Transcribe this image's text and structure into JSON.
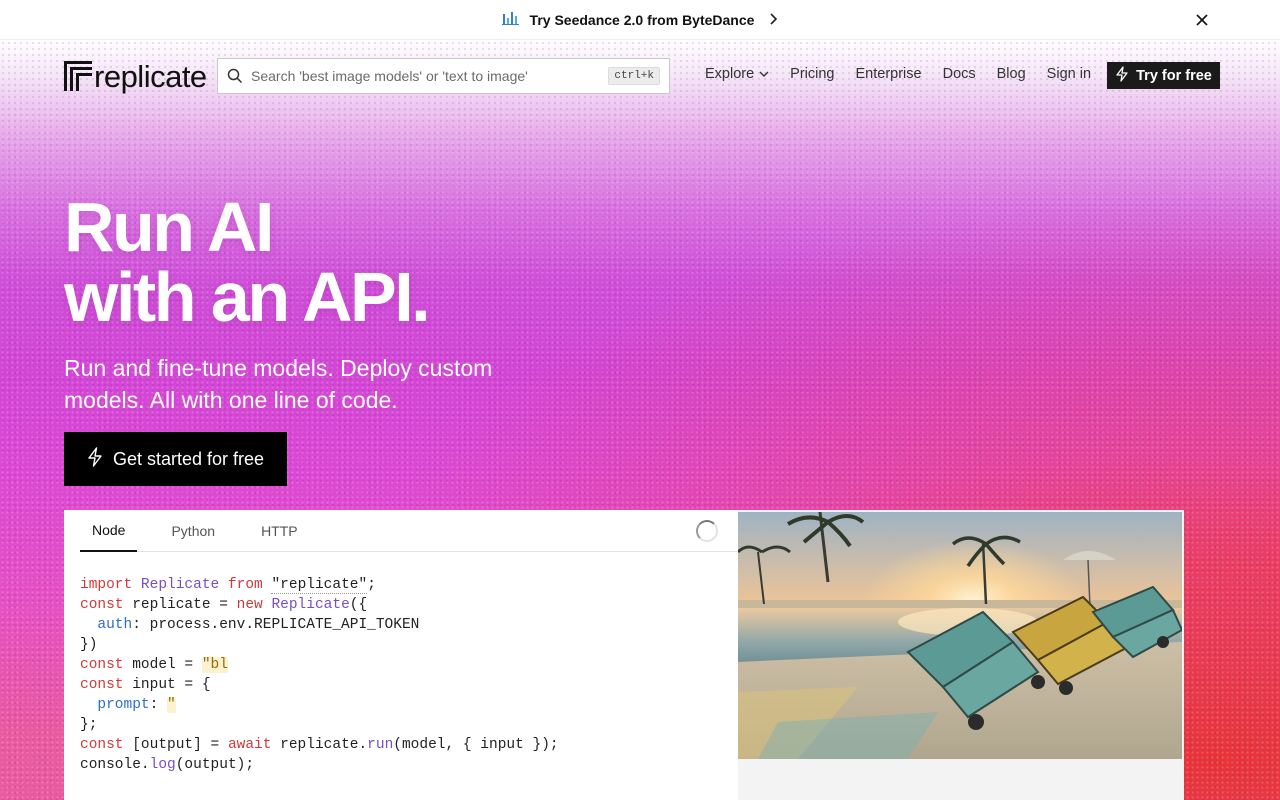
{
  "announcement": {
    "text": "Try Seedance 2.0 from ByteDance",
    "icon": "bar-chart-icon",
    "close_icon": "close-icon"
  },
  "nav": {
    "logo_text": "replicate",
    "search_placeholder": "Search 'best image models' or 'text to image'",
    "search_shortcut": "ctrl+k",
    "links": [
      "Explore",
      "Pricing",
      "Enterprise",
      "Docs",
      "Blog",
      "Sign in"
    ],
    "cta_label": "Try for free"
  },
  "hero": {
    "title_line1": "Run AI",
    "title_line2": "with an API.",
    "subtitle": "Run and fine-tune models. Deploy custom models. All with one line of code.",
    "cta_label": "Get started for free"
  },
  "code_panel": {
    "tabs": [
      "Node",
      "Python",
      "HTTP"
    ],
    "active_tab": "Node",
    "lines": [
      "import Replicate from \"replicate\";",
      "const replicate = new Replicate({",
      "  auth: process.env.REPLICATE_API_TOKEN",
      "})",
      "const model = \"bl",
      "const input = {",
      "  prompt: \"",
      "};",
      "const [output] = await replicate.run(model, { input });",
      "console.log(output);"
    ]
  },
  "colors": {
    "accent": "#111111",
    "hero_top": "#d870e0",
    "hero_bottom_right": "#e83232"
  }
}
